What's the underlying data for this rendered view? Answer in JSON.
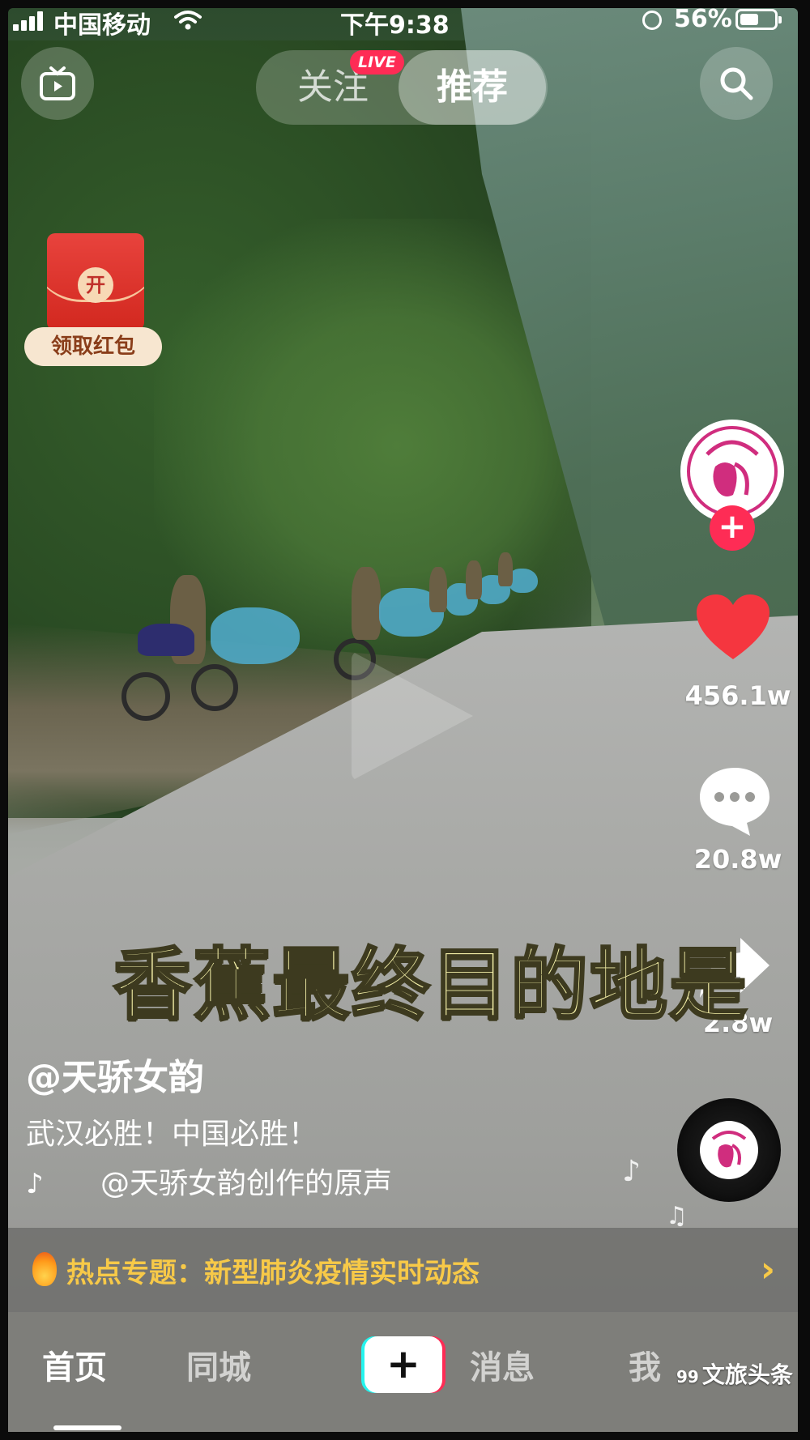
{
  "status_bar": {
    "carrier": "中国移动",
    "time": "下午9:38",
    "battery_percent": "56%",
    "battery_level": 0.56
  },
  "top_nav": {
    "tabs": [
      {
        "label": "关注",
        "active": false
      },
      {
        "label": "推荐",
        "active": true
      }
    ],
    "live_badge": "LIVE",
    "left_icon": "tv-icon",
    "right_icon": "search-icon"
  },
  "red_packet": {
    "coin_text": "开",
    "label": "领取红包"
  },
  "right_rail": {
    "likes": "456.1w",
    "comments": "20.8w",
    "shares": "2.8w"
  },
  "video": {
    "caption": "香蕉最终目的地是",
    "author": "@天骄女韵",
    "description": "武汉必胜！中国必胜！",
    "music": "@天骄女韵创作的原声"
  },
  "hot_topic": {
    "label": "热点专题：新型肺炎疫情实时动态"
  },
  "bottom_nav": {
    "items": [
      {
        "label": "首页",
        "active": true
      },
      {
        "label": "同城",
        "active": false
      },
      {
        "label": "消息",
        "active": false
      },
      {
        "label": "我",
        "active": false
      }
    ],
    "plus_label": "+"
  },
  "watermark": {
    "text": "文旅头条",
    "prefix": "99"
  },
  "colors": {
    "accent": "#fe2c55",
    "cyan": "#25f4ee",
    "hot_text": "#f7c948",
    "caption": "#f4f0a8"
  }
}
